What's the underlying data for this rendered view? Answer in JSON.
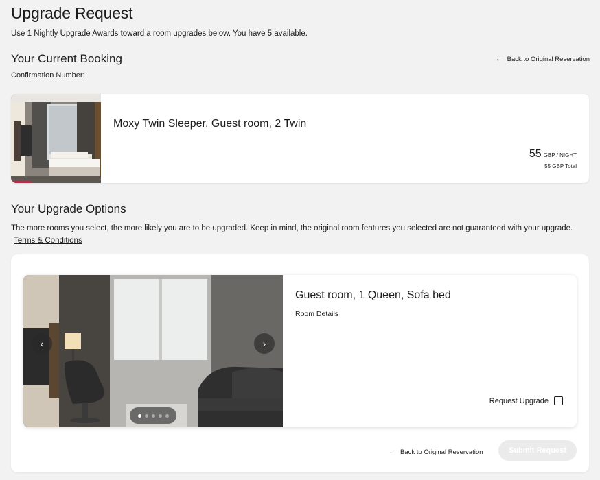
{
  "page": {
    "title": "Upgrade Request",
    "awards_text": "Use 1 Nightly Upgrade Awards toward a room upgrades below. You have 5 available."
  },
  "current_booking": {
    "heading": "Your Current Booking",
    "back_link": "Back to Original Reservation",
    "confirmation_label": "Confirmation Number:",
    "room_name": "Moxy Twin Sleeper, Guest room, 2 Twin",
    "price": "55",
    "price_unit": "GBP / NIGHT",
    "price_total": "55 GBP Total"
  },
  "upgrade_options": {
    "heading": "Your Upgrade Options",
    "description": "The more rooms you select, the more likely you are to be upgraded. Keep in mind, the original room features you selected are not guaranteed with your upgrade.",
    "terms_link": "Terms & Conditions",
    "options": [
      {
        "room_name": "Guest room, 1 Queen, Sofa bed",
        "room_details_link": "Room Details",
        "request_upgrade_label": "Request Upgrade",
        "request_upgrade_checked": false,
        "carousel_image_count": 5,
        "carousel_active_index": 0
      }
    ],
    "back_link": "Back to Original Reservation",
    "submit_label": "Submit Request"
  },
  "icons": {
    "back_arrow": "arrow-left-icon",
    "prev": "chevron-left-icon",
    "next": "chevron-right-icon"
  },
  "colors": {
    "background": "#f2f2f2",
    "card": "#ffffff",
    "submit_disabled": "#ebebeb"
  }
}
